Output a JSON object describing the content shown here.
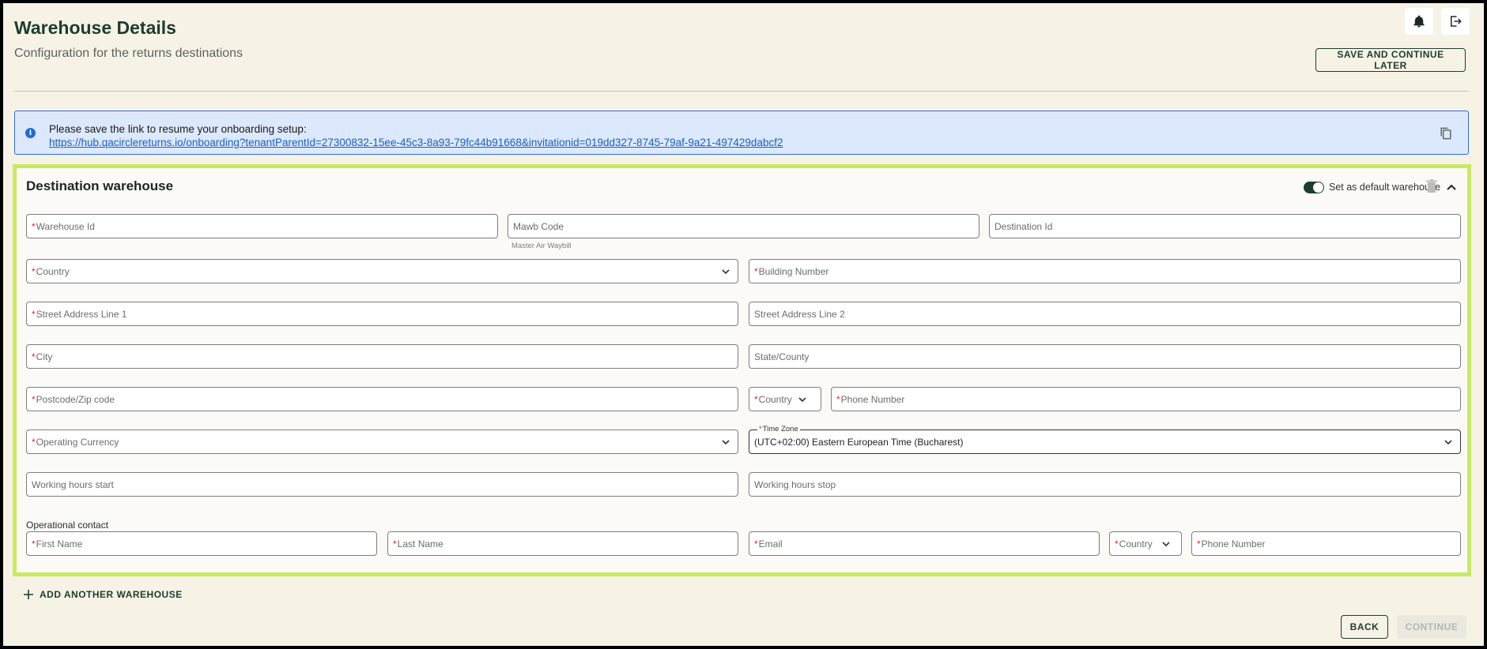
{
  "header": {
    "title": "Warehouse Details",
    "subtitle": "Configuration for the returns destinations",
    "save_later_label": "SAVE AND CONTINUE LATER",
    "notifications_icon": "bell-icon",
    "logout_icon": "logout-icon"
  },
  "info": {
    "message": "Please save the link to resume your onboarding setup:",
    "link": "https://hub.qacirclereturns.io/onboarding?tenantParentId=27300832-15ee-45c3-8a93-79fc44b91668&invitationid=019dd327-8745-79af-9a21-497429dabcf2",
    "info_icon": "i"
  },
  "card": {
    "title": "Destination warehouse",
    "default_toggle_label": "Set as default warehouse",
    "default_toggle_on": true,
    "fields": {
      "warehouse_id": "Warehouse Id",
      "mawb_code": "Mawb Code",
      "mawb_helper": "Master Air Waybill",
      "destination_id": "Destination Id",
      "country": "Country",
      "building_number": "Building Number",
      "street1": "Street Address Line 1",
      "street2": "Street Address Line 2",
      "city": "City",
      "state": "State/County",
      "postcode": "Postcode/Zip code",
      "phone_country": "Country",
      "phone_number": "Phone Number",
      "operating_currency": "Operating Currency",
      "time_zone_label": "Time Zone",
      "time_zone_value": "(UTC+02:00) Eastern European Time (Bucharest)",
      "working_start": "Working hours start",
      "working_stop": "Working hours stop"
    },
    "operational_contact": {
      "label": "Operational contact",
      "first_name": "First Name",
      "last_name": "Last Name",
      "email": "Email",
      "country": "Country",
      "phone_number": "Phone Number"
    },
    "required_marker": "*"
  },
  "footer": {
    "add_warehouse_label": "ADD ANOTHER WAREHOUSE",
    "back_label": "BACK",
    "continue_label": "CONTINUE"
  },
  "colors": {
    "accent": "#1d3d2c",
    "card_border": "#c8ea62",
    "info_bg": "#dce8fb",
    "required": "#d0301e"
  }
}
